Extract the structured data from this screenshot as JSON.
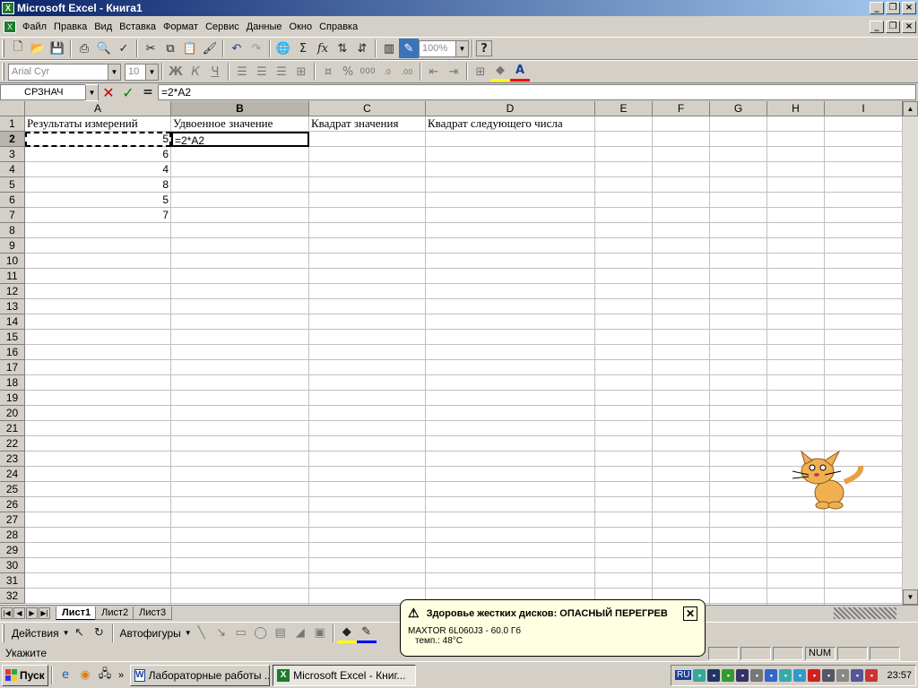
{
  "window": {
    "title": "Microsoft Excel - Книга1"
  },
  "menu": [
    "Файл",
    "Правка",
    "Вид",
    "Вставка",
    "Формат",
    "Сервис",
    "Данные",
    "Окно",
    "Справка"
  ],
  "toolbar": {
    "zoom": "100%"
  },
  "format_toolbar": {
    "font": "Arial Cyr",
    "size": "10"
  },
  "formula_bar": {
    "name_box": "СРЗНАЧ",
    "formula": "=2*A2",
    "fx_equals": "="
  },
  "columns": [
    "A",
    "B",
    "C",
    "D",
    "E",
    "F",
    "G",
    "H",
    "I"
  ],
  "rows": [
    "1",
    "2",
    "3",
    "4",
    "5",
    "6",
    "7",
    "8",
    "9",
    "10",
    "11",
    "12",
    "13",
    "14",
    "15",
    "16",
    "17",
    "18",
    "19",
    "20",
    "21",
    "22",
    "23",
    "24",
    "25",
    "26",
    "27",
    "28",
    "29",
    "30",
    "31",
    "32"
  ],
  "cells": {
    "A1": "Результаты измерений",
    "B1": "Удвоенное значение",
    "C1": "Квадрат значения",
    "D1": "Квадрат следующего числа",
    "A2": "5",
    "B2": "=2*A2",
    "A3": "6",
    "A4": "4",
    "A5": "8",
    "A6": "5",
    "A7": "7"
  },
  "sheets": [
    "Лист1",
    "Лист2",
    "Лист3"
  ],
  "draw_toolbar": {
    "actions": "Действия",
    "autoshapes": "Автофигуры"
  },
  "status": {
    "mode": "Укажите",
    "num": "NUM"
  },
  "balloon": {
    "title": "Здоровье жестких дисков: ОПАСНЫЙ ПЕРЕГРЕВ",
    "line1": "MAXTOR 6L060J3 - 60.0 Гб",
    "line2": "темп.: 48°C"
  },
  "taskbar": {
    "start": "Пуск",
    "task1": "Лабораторные работы ...",
    "task2": "Microsoft Excel - Книг...",
    "lang": "RU",
    "clock": "23:57"
  }
}
